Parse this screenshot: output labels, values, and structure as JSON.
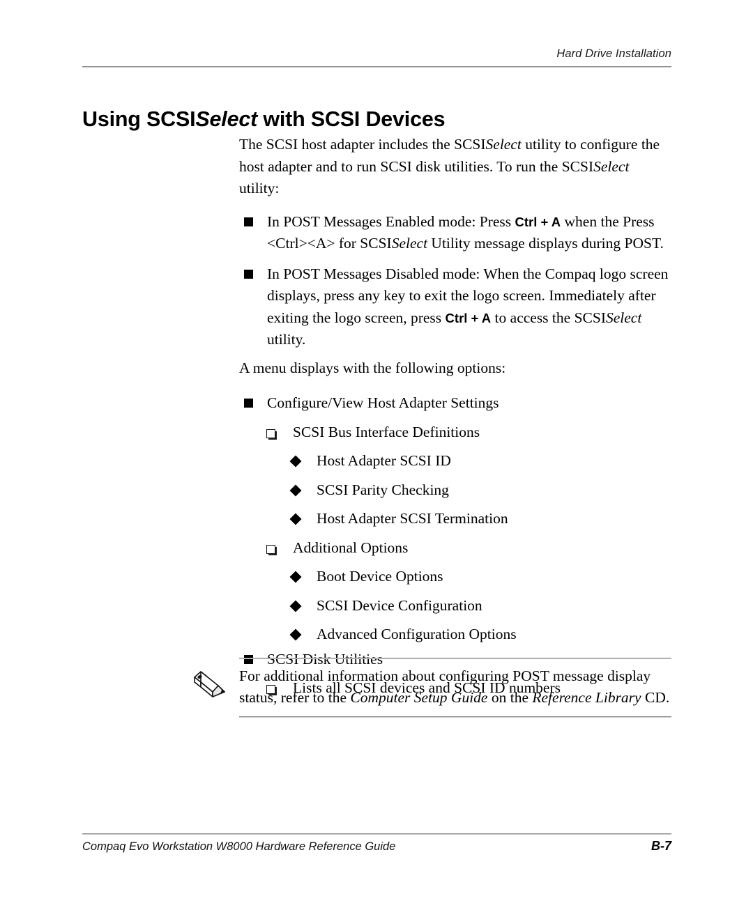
{
  "header": {
    "running_head": "Hard Drive Installation"
  },
  "title": {
    "part1": "Using SCSI",
    "part2_italic": "Select",
    "part3": " with SCSI Devices"
  },
  "intro": {
    "line": "The SCSI host adapter includes the SCSI",
    "scsiselect_a": "Select",
    "mid": " utility to configure the host adapter and to run SCSI disk utilities. To run the SCSI",
    "scsiselect_b": "Select",
    "tail": " utility:"
  },
  "bullets_top": [
    {
      "pre": "In POST Messages Enabled mode: Press ",
      "kbd": "Ctrl + A",
      "mid": " when the Press <Ctrl><A> for SCSI",
      "ital": "Select",
      "post": " Utility message displays during POST."
    },
    {
      "pre": "In POST Messages Disabled mode: When the Compaq logo screen displays, press any key to exit the logo screen. Immediately after exiting the logo screen, press ",
      "kbd": "Ctrl + A",
      "mid": " to access the SCSI",
      "ital": "Select",
      "post": " utility."
    }
  ],
  "menu_lead": "A menu displays with the following options:",
  "menu": [
    {
      "level": 1,
      "label": "Configure/View Host Adapter Settings"
    },
    {
      "level": 2,
      "label": "SCSI Bus Interface Definitions"
    },
    {
      "level": 3,
      "label": "Host Adapter SCSI ID"
    },
    {
      "level": 3,
      "label": "SCSI Parity Checking"
    },
    {
      "level": 3,
      "label": "Host Adapter SCSI Termination"
    },
    {
      "level": 2,
      "label": "Additional Options"
    },
    {
      "level": 3,
      "label": "Boot Device Options"
    },
    {
      "level": 3,
      "label": "SCSI Device Configuration"
    },
    {
      "level": 3,
      "label": "Advanced Configuration Options"
    },
    {
      "level": 1,
      "label": "SCSI Disk Utilities"
    },
    {
      "level": 2,
      "label": "Lists all SCSI devices and SCSI ID numbers"
    }
  ],
  "note": {
    "icon": "pencil-icon",
    "part1": "For additional information about configuring POST message display status, refer to the ",
    "ital1": "Computer Setup Guide",
    "part2": " on the ",
    "ital2": "Reference Library",
    "part3": " CD."
  },
  "footer": {
    "left": "Compaq Evo Workstation W8000 Hardware Reference Guide",
    "page": "B-7"
  },
  "colors": {
    "text": "#000000",
    "rule": "#8a8a8a",
    "paper": "#ffffff"
  }
}
